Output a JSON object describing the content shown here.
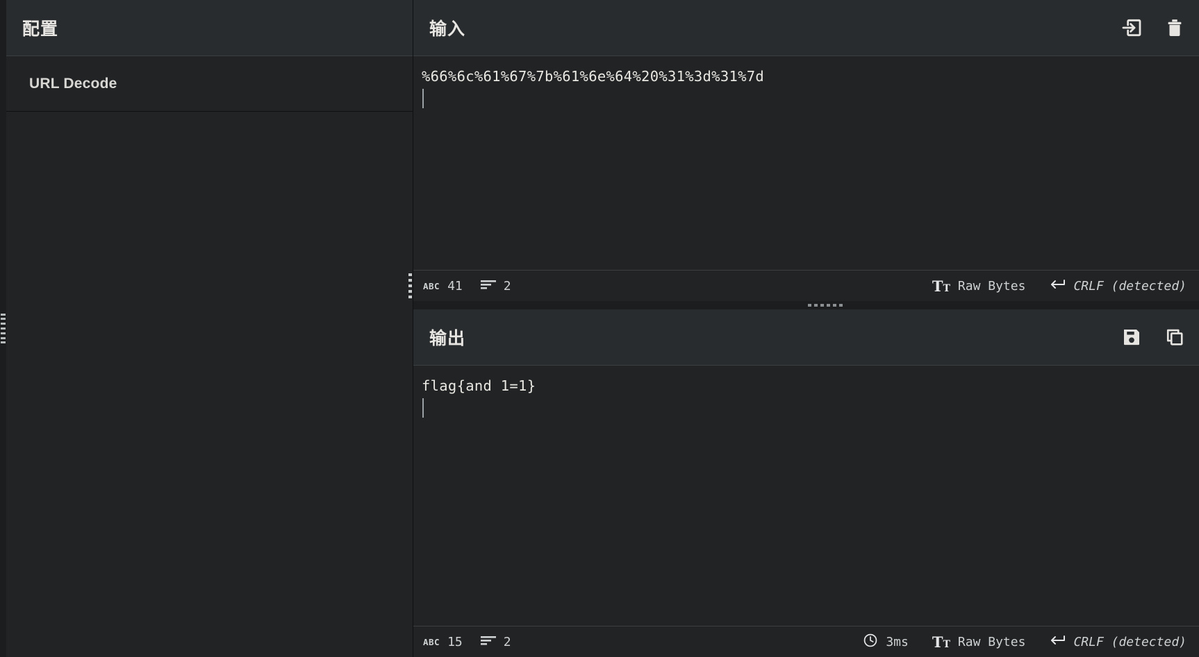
{
  "config": {
    "title": "配置",
    "items": [
      {
        "label": "URL Decode"
      }
    ]
  },
  "input": {
    "title": "输入",
    "content": "%66%6c%61%67%7b%61%6e%64%20%31%3d%31%7d",
    "actions": [
      {
        "name": "import-input-icon",
        "tooltip": "Import"
      },
      {
        "name": "trash-icon",
        "tooltip": "Clear"
      }
    ],
    "status": {
      "chars_icon": "ABC",
      "chars": "41",
      "lines_icon": "lines-icon",
      "lines": "2",
      "encoding_icon": "Tt",
      "encoding": "Raw Bytes",
      "linebreak_icon": "return-arrow",
      "linebreak": "CRLF (detected)"
    }
  },
  "output": {
    "title": "输出",
    "content": "flag{and 1=1}",
    "actions": [
      {
        "name": "save-icon",
        "tooltip": "Save"
      },
      {
        "name": "copy-icon",
        "tooltip": "Copy"
      }
    ],
    "status": {
      "chars_icon": "ABC",
      "chars": "15",
      "lines_icon": "lines-icon",
      "lines": "2",
      "duration_icon": "clock-icon",
      "duration": "3ms",
      "encoding_icon": "Tt",
      "encoding": "Raw Bytes",
      "linebreak_icon": "return-arrow",
      "linebreak": "CRLF (detected)"
    }
  },
  "colors": {
    "background": "#1b1d1e",
    "panel": "#212325",
    "header": "#292c2e",
    "text": "#e8e6e3",
    "muted": "#cfd2d3",
    "border": "#3c3f41"
  }
}
